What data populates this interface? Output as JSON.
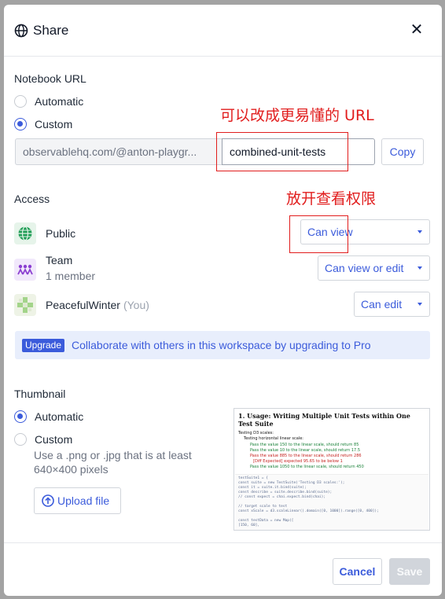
{
  "dialog": {
    "title": "Share",
    "close_glyph": "✕",
    "icon": "globe-icon"
  },
  "notebook_url": {
    "section_label": "Notebook URL",
    "options": {
      "automatic": "Automatic",
      "custom": "Custom"
    },
    "selected": "custom",
    "prefix": "observablehq.com/@anton-playgr...",
    "slug_value": "combined-unit-tests",
    "copy_label": "Copy"
  },
  "annotations": {
    "url_note": "可以改成更易懂的 URL",
    "access_note": "放开查看权限",
    "color": "#e11d1d"
  },
  "access": {
    "section_label": "Access",
    "rows": [
      {
        "name": "Public",
        "permission": "Can view",
        "icon": "globe-icon"
      },
      {
        "name": "Team",
        "sub": "1 member",
        "permission": "Can view or edit",
        "icon": "team-icon"
      },
      {
        "name": "PeacefulWinter",
        "you": "(You)",
        "permission": "Can edit",
        "icon": "user-avatar-icon"
      }
    ]
  },
  "upgrade": {
    "badge": "Upgrade",
    "text": "Collaborate with others in this workspace by upgrading to Pro"
  },
  "thumbnail": {
    "section_label": "Thumbnail",
    "options": {
      "automatic": "Automatic",
      "custom": "Custom"
    },
    "selected": "automatic",
    "hint": "Use a .png or .jpg that is at least 640×400 pixels",
    "upload_label": "Upload file",
    "preview": {
      "title": "1. Usage: Writing Multiple Unit Tests within One Test Suite",
      "lines": [
        "Testing D3 scales:",
        "Testing horizontal linear scale:",
        "Pass the value 150 to the linear scale, should return 85",
        "Pass the value 10 to the linear scale, should return 17.5",
        "Pass the value 885 to the linear scale, should return 286",
        "[Diff Expected] expected 95.65 to be below 1",
        "Pass the value 1050 to the linear scale, should return 450"
      ],
      "code": [
        "testSuite1 = {",
        "  const suite = new TestSuite('Testing D3 scales:');",
        "  const it = suite.it.bind(suite);",
        "  const describe = suite.describe.bind(suite);",
        "  // const expect = chai.expect.bind(chai);",
        "",
        "  // target scale to test",
        "  const xScale = d3.scaleLinear().domain([0, 1000]).range([0, 400]);",
        "",
        "  const testData = new Map([",
        "    [150, 60],"
      ]
    }
  },
  "footer": {
    "cancel_label": "Cancel",
    "save_label": "Save"
  }
}
